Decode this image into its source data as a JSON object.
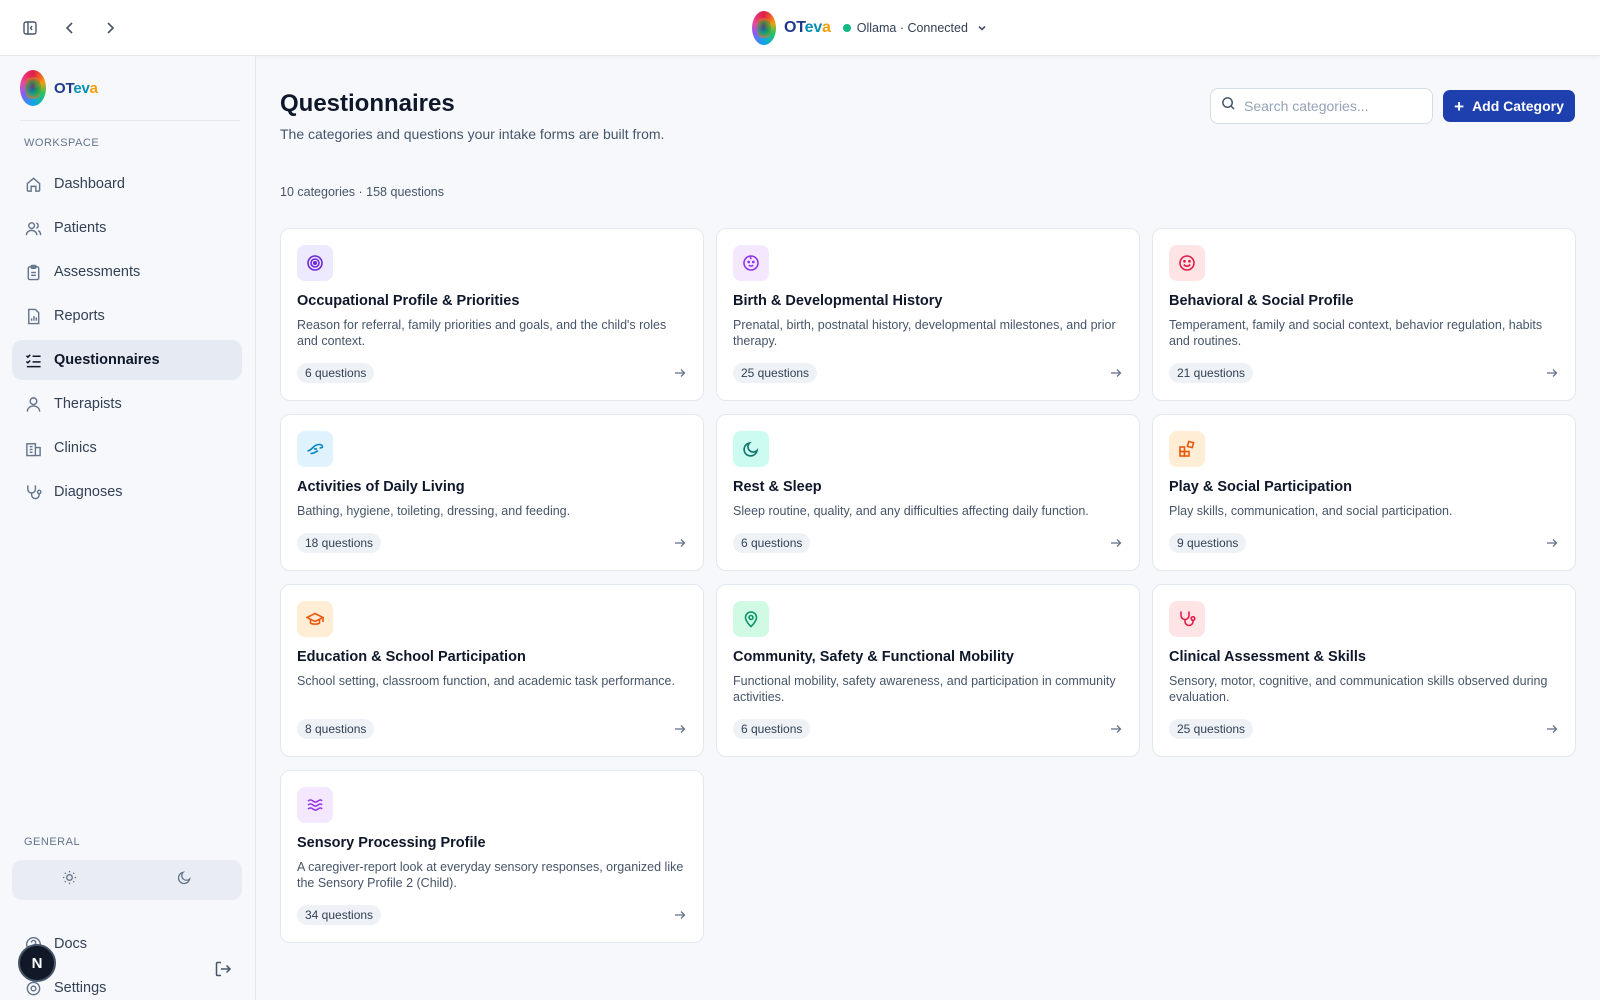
{
  "topbar": {
    "brand": {
      "part1": "OT",
      "part2": "ev",
      "part3": "a"
    },
    "status": "Ollama · Connected"
  },
  "sidebar": {
    "brand": {
      "part1": "OT",
      "part2": "ev",
      "part3": "a"
    },
    "workspace_label": "WORKSPACE",
    "general_label": "GENERAL",
    "items": [
      {
        "label": "Dashboard",
        "icon": "home-icon"
      },
      {
        "label": "Patients",
        "icon": "users-icon"
      },
      {
        "label": "Assessments",
        "icon": "clipboard-icon"
      },
      {
        "label": "Reports",
        "icon": "file-chart-icon"
      },
      {
        "label": "Questionnaires",
        "icon": "list-checks-icon",
        "active": true
      },
      {
        "label": "Therapists",
        "icon": "user-icon"
      },
      {
        "label": "Clinics",
        "icon": "building-icon"
      },
      {
        "label": "Diagnoses",
        "icon": "stethoscope-icon"
      }
    ],
    "general_items": [
      {
        "label": "Docs",
        "icon": "help-circle-icon"
      },
      {
        "label": "Settings",
        "icon": "settings-icon"
      }
    ],
    "avatar_initial": "N"
  },
  "main": {
    "title": "Questionnaires",
    "subtitle": "The categories and questions your intake forms are built from.",
    "search_placeholder": "Search categories...",
    "add_button": "Add Category",
    "counts": "10 categories · 158 questions",
    "cards": [
      {
        "title": "Occupational Profile & Priorities",
        "description": "Reason for referral, family priorities and goals, and the child's roles and context.",
        "badge": "6 questions",
        "icon": "target-icon",
        "icon_bg": "#ede9fe",
        "icon_color": "#6d28d9"
      },
      {
        "title": "Birth & Developmental History",
        "description": "Prenatal, birth, postnatal history, developmental milestones, and prior therapy.",
        "badge": "25 questions",
        "icon": "baby-icon",
        "icon_bg": "#f3e8ff",
        "icon_color": "#9333ea"
      },
      {
        "title": "Behavioral & Social Profile",
        "description": "Temperament, family and social context, behavior regulation, habits and routines.",
        "badge": "21 questions",
        "icon": "smile-icon",
        "icon_bg": "#ffe4e6",
        "icon_color": "#e11d48"
      },
      {
        "title": "Activities of Daily Living",
        "description": "Bathing, hygiene, toileting, dressing, and feeding.",
        "badge": "18 questions",
        "icon": "hand-icon",
        "icon_bg": "#e0f2fe",
        "icon_color": "#0284c7"
      },
      {
        "title": "Rest & Sleep",
        "description": "Sleep routine, quality, and any difficulties affecting daily function.",
        "badge": "6 questions",
        "icon": "moon-icon",
        "icon_bg": "#ccfbf1",
        "icon_color": "#0f766e"
      },
      {
        "title": "Play & Social Participation",
        "description": "Play skills, communication, and social participation.",
        "badge": "9 questions",
        "icon": "blocks-icon",
        "icon_bg": "#ffedd5",
        "icon_color": "#ea580c"
      },
      {
        "title": "Education & School Participation",
        "description": "School setting, classroom function, and academic task performance.",
        "badge": "8 questions",
        "icon": "graduation-cap-icon",
        "icon_bg": "#ffedd5",
        "icon_color": "#ea580c"
      },
      {
        "title": "Community, Safety & Functional Mobility",
        "description": "Functional mobility, safety awareness, and participation in community activities.",
        "badge": "6 questions",
        "icon": "map-pin-icon",
        "icon_bg": "#d1fae5",
        "icon_color": "#059669"
      },
      {
        "title": "Clinical Assessment & Skills",
        "description": "Sensory, motor, cognitive, and communication skills observed during evaluation.",
        "badge": "25 questions",
        "icon": "stethoscope-icon",
        "icon_bg": "#ffe4e6",
        "icon_color": "#e11d48"
      },
      {
        "title": "Sensory Processing Profile",
        "description": "A caregiver-report look at everyday sensory responses, organized like the Sensory Profile 2 (Child).",
        "badge": "34 questions",
        "icon": "waves-icon",
        "icon_bg": "#f3e8ff",
        "icon_color": "#9333ea"
      }
    ]
  }
}
